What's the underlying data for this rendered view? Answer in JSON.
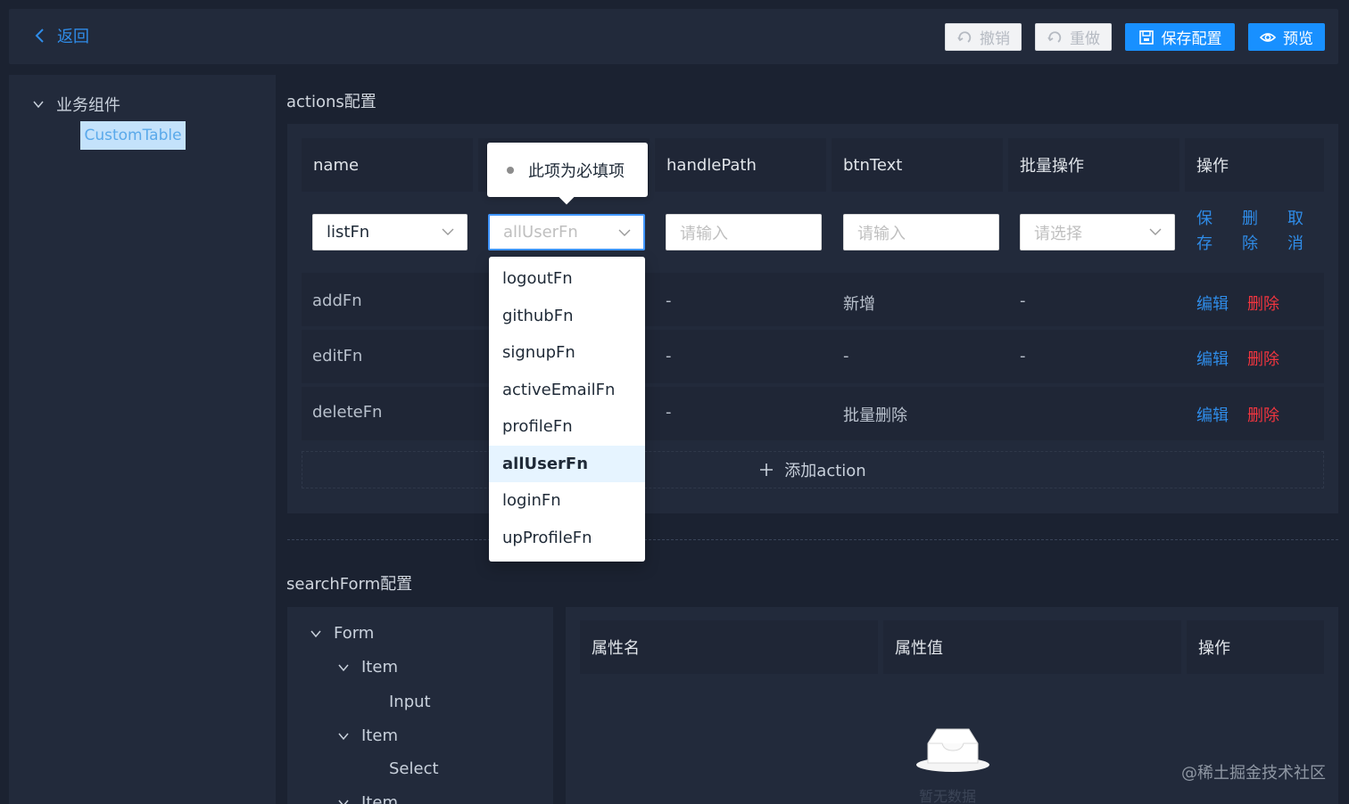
{
  "header": {
    "back_label": "返回",
    "undo_label": "撤销",
    "redo_label": "重做",
    "save_label": "保存配置",
    "preview_label": "预览"
  },
  "sidebar": {
    "group_label": "业务组件",
    "item_label": "CustomTable"
  },
  "actions_section": {
    "title": "actions配置",
    "columns": [
      "name",
      "handlePath",
      "btnText",
      "批量操作",
      "操作"
    ],
    "edit_row": {
      "name_value": "listFn",
      "handle_value": "allUserFn",
      "handlepath_placeholder": "请输入",
      "btntext_placeholder": "请输入",
      "batch_placeholder": "请选择",
      "ops": [
        "保存",
        "删除",
        "取消"
      ]
    },
    "rows": [
      {
        "name": "addFn",
        "handlePath": "-",
        "btnText": "新增",
        "batch": "-",
        "edit": "编辑",
        "del": "删除"
      },
      {
        "name": "editFn",
        "handlePath": "-",
        "btnText": "-",
        "batch": "-",
        "edit": "编辑",
        "del": "删除"
      },
      {
        "name": "deleteFn",
        "handlePath": "-",
        "btnText": "批量删除",
        "batch": "",
        "edit": "编辑",
        "del": "删除"
      }
    ],
    "add_label": "添加action",
    "tooltip": "此项为必填项",
    "dropdown_options": [
      "logoutFn",
      "githubFn",
      "signupFn",
      "activeEmailFn",
      "profileFn",
      "allUserFn",
      "loginFn",
      "upProfileFn"
    ],
    "dropdown_selected": "allUserFn"
  },
  "search_section": {
    "title": "searchForm配置",
    "tree": {
      "form": "Form",
      "item1": "Item",
      "input": "Input",
      "item2": "Item",
      "select": "Select",
      "item3": "Item"
    },
    "columns": [
      "属性名",
      "属性值",
      "操作"
    ],
    "empty_text": "暂无数据"
  },
  "watermark": "@稀土掘金技术社区"
}
